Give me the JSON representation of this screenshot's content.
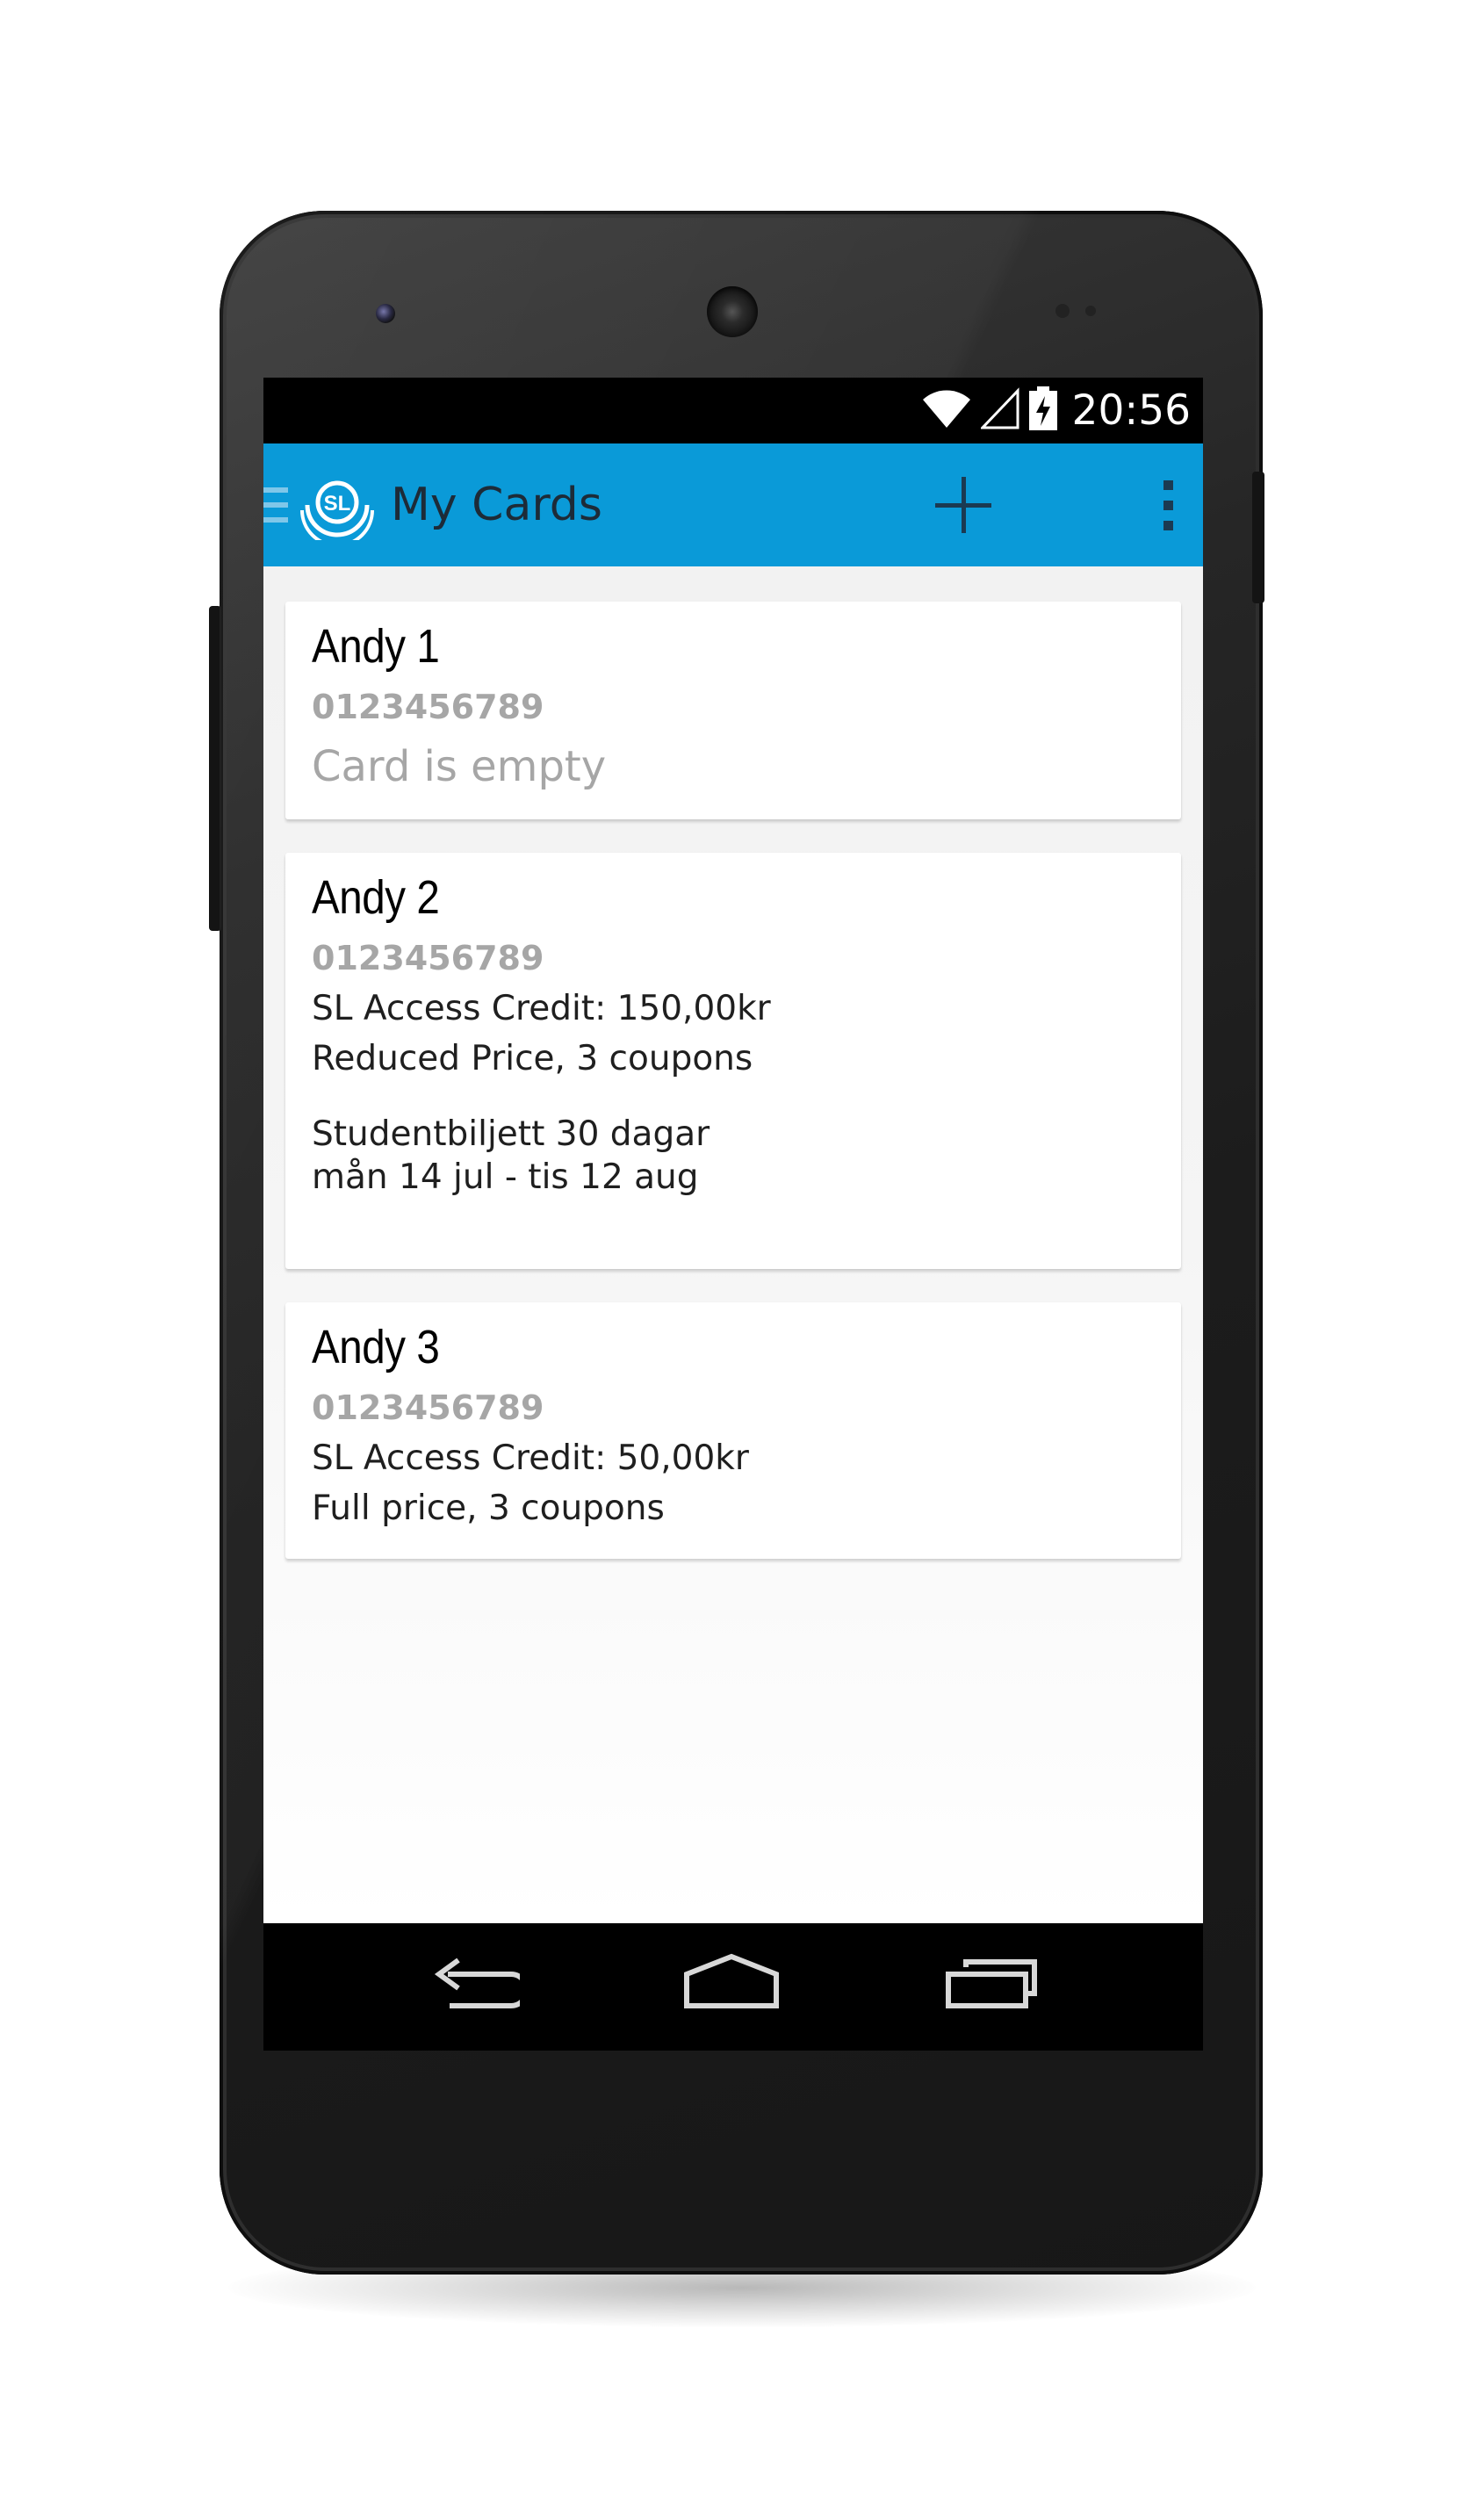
{
  "status_bar": {
    "time": "20:56"
  },
  "action_bar": {
    "title": "My Cards",
    "color": "#0a9ad8"
  },
  "cards": [
    {
      "name": "Andy 1",
      "number": "0123456789",
      "empty_text": "Card is empty"
    },
    {
      "name": "Andy 2",
      "number": "0123456789",
      "credit": "SL Access Credit: 150,00kr",
      "price_type": "Reduced Price, 3 coupons",
      "ticket_name": "Studentbiljett 30 dagar",
      "ticket_period": "mån 14 jul - tis 12 aug"
    },
    {
      "name": "Andy 3",
      "number": "0123456789",
      "credit": "SL Access Credit: 50,00kr",
      "price_type": "Full price, 3 coupons"
    }
  ],
  "icons": {
    "status": [
      "wifi-icon",
      "signal-icon",
      "battery-charging-icon"
    ],
    "action_bar": [
      "drawer-indicator-icon",
      "sl-logo-icon",
      "add-icon",
      "overflow-menu-icon"
    ],
    "navigation": [
      "back-icon",
      "home-icon",
      "recent-apps-icon"
    ]
  }
}
